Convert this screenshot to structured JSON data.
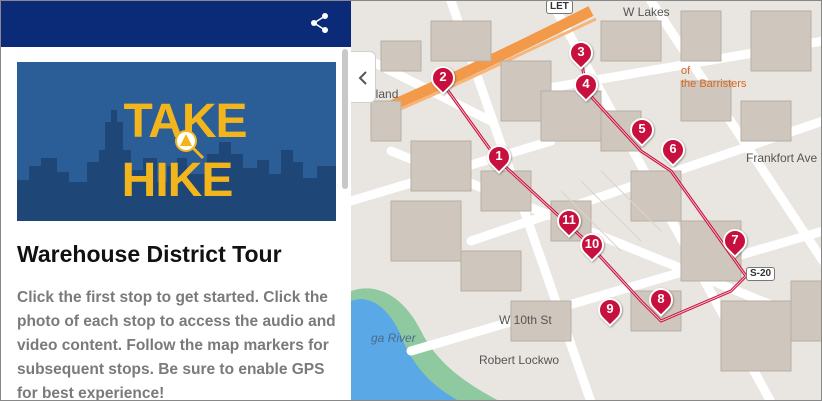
{
  "sidebar": {
    "title": "Warehouse District Tour",
    "description": "Click the first stop to get started. Click the photo of each stop to access the audio and video content. Follow the map markers for subsequent stops. Be sure to enable GPS for best experience!",
    "hero": {
      "line1": "TAKE",
      "line2": "HIKE",
      "bg_color": "#2b5d96",
      "text_color": "#f2b51c"
    }
  },
  "map": {
    "street_labels": {
      "w_lakeside": "W Lakes",
      "frankfort": "Frankfort Ave",
      "w_10th": "W 10th St",
      "robert_lockwood": "Robert Lockwo",
      "river": "ga River",
      "cleveland": "eland"
    },
    "poi": {
      "line1": "of",
      "line2": "the Barristers"
    },
    "shields": {
      "let": "LET",
      "i20": "S-20"
    },
    "markers": [
      "1",
      "2",
      "3",
      "4",
      "5",
      "6",
      "7",
      "8",
      "9",
      "10",
      "11"
    ],
    "route_color": "#c8103e"
  }
}
